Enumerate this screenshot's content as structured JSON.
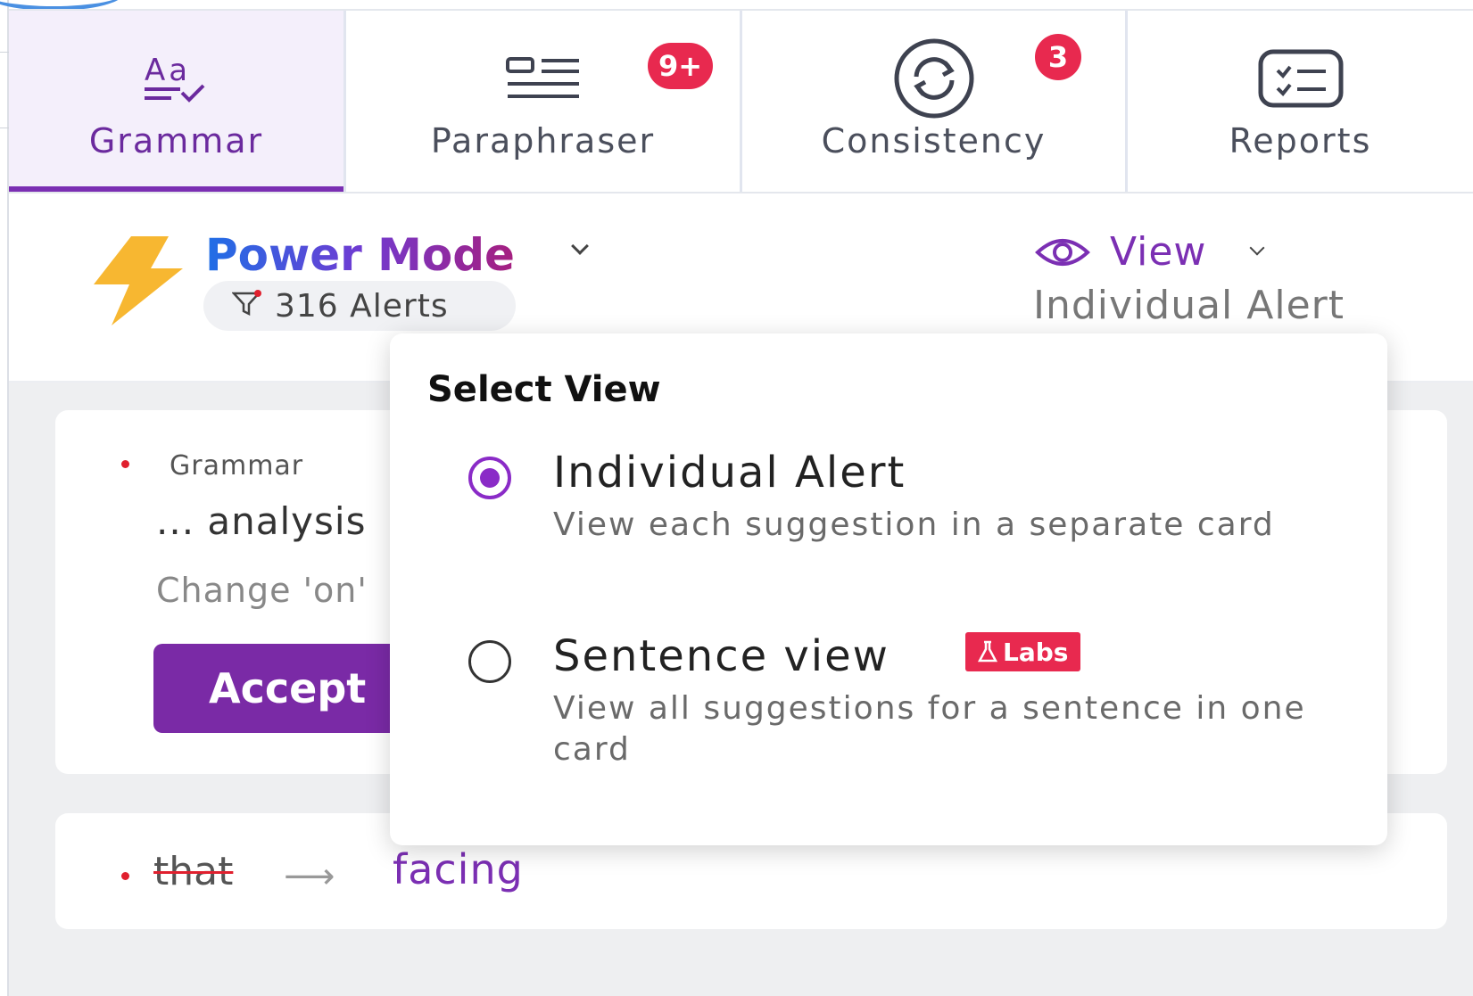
{
  "tabs": [
    {
      "label": "Grammar",
      "icon": "grammar-icon",
      "active": true
    },
    {
      "label": "Paraphraser",
      "icon": "paraphraser-icon",
      "badge": "9+"
    },
    {
      "label": "Consistency",
      "icon": "consistency-icon",
      "badge": "3"
    },
    {
      "label": "Reports",
      "icon": "reports-icon"
    }
  ],
  "mode": {
    "title": "Power Mode",
    "icon": "lightning-bolt-icon",
    "alerts": "316 Alerts"
  },
  "view": {
    "label": "View",
    "value": "Individual Alert"
  },
  "card": {
    "category": "Grammar",
    "snippet": "... analysis",
    "hint": "Change 'on'",
    "accept_label": "Accept"
  },
  "suggestion": {
    "original": "that",
    "replacement": "facing"
  },
  "select_view": {
    "title": "Select View",
    "options": [
      {
        "title": "Individual Alert",
        "description": "View each suggestion in a separate card",
        "selected": true
      },
      {
        "title": "Sentence view",
        "description": "View all suggestions for a sentence in one card",
        "selected": false,
        "badge": "Labs"
      }
    ]
  },
  "colors": {
    "accent": "#7b2fb3",
    "badge": "#e8294f",
    "bolt": "#f7b731"
  }
}
